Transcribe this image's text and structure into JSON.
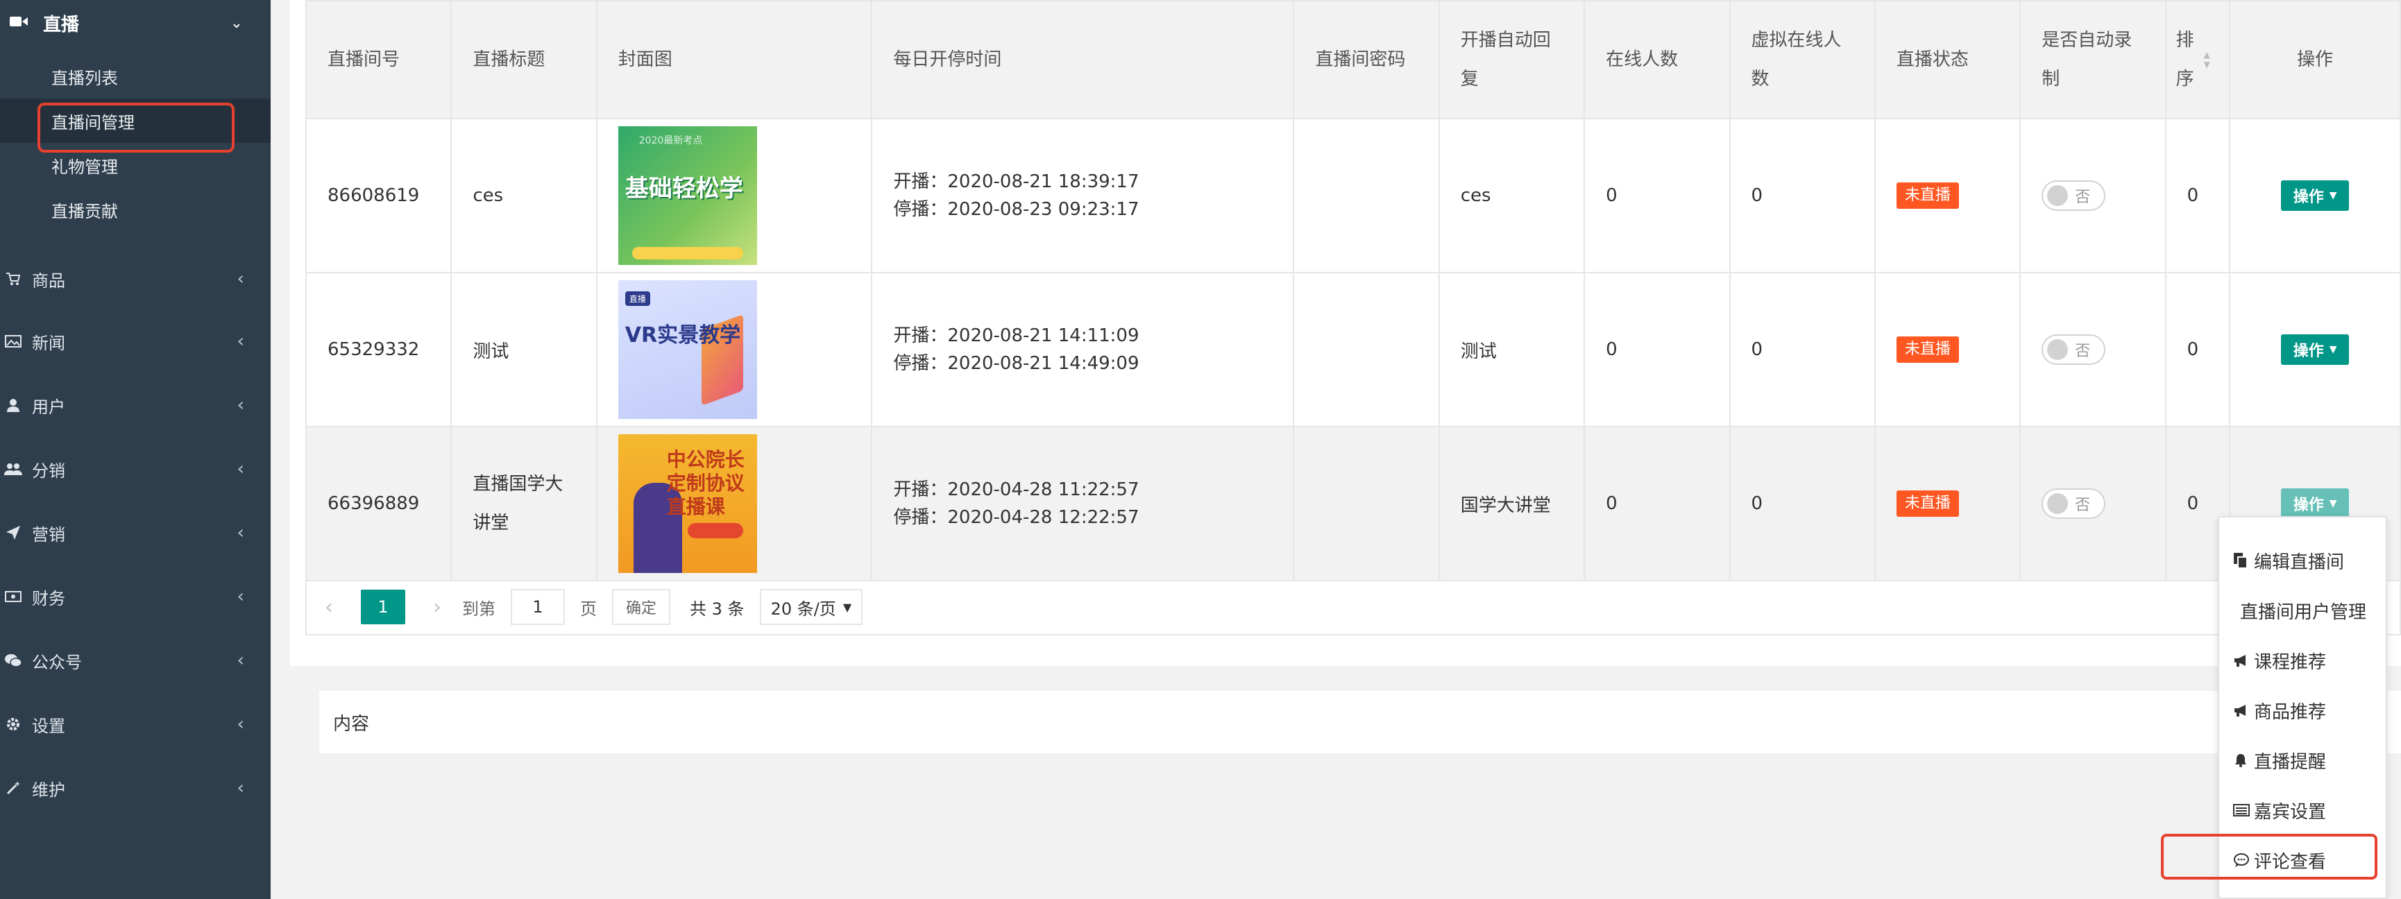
{
  "sidebar": {
    "active_section": "直播",
    "sub_items": [
      "直播列表",
      "直播间管理",
      "礼物管理",
      "直播贡献"
    ],
    "items": [
      {
        "label": "商品",
        "icon": "cart-icon"
      },
      {
        "label": "新闻",
        "icon": "image-icon"
      },
      {
        "label": "用户",
        "icon": "user-icon"
      },
      {
        "label": "分销",
        "icon": "users-icon"
      },
      {
        "label": "营销",
        "icon": "send-icon"
      },
      {
        "label": "财务",
        "icon": "money-icon"
      },
      {
        "label": "公众号",
        "icon": "wechat-icon"
      },
      {
        "label": "设置",
        "icon": "gear-icon"
      },
      {
        "label": "维护",
        "icon": "wand-icon"
      }
    ]
  },
  "table": {
    "headers": [
      "直播间号",
      "直播标题",
      "封面图",
      "每日开停时间",
      "直播间密码",
      "开播自动回复",
      "在线人数",
      "虚拟在线人数",
      "直播状态",
      "是否自动录制",
      "排序",
      "操作"
    ],
    "rows": [
      {
        "room_no": "86608619",
        "title": "ces",
        "cover_text": "基础轻松学",
        "cover_tag": "2020最新考点",
        "start": "开播：2020-08-21 18:39:17",
        "stop": "停播：2020-08-23 09:23:17",
        "password": "",
        "auto_reply": "ces",
        "online": "0",
        "virtual_online": "0",
        "status": "未直播",
        "record": "否",
        "sort": "0",
        "op": "操作"
      },
      {
        "room_no": "65329332",
        "title": "测试",
        "cover_text": "VR实景教学",
        "cover_tag": "直播",
        "start": "开播：2020-08-21 14:11:09",
        "stop": "停播：2020-08-21 14:49:09",
        "password": "",
        "auto_reply": "测试",
        "online": "0",
        "virtual_online": "0",
        "status": "未直播",
        "record": "否",
        "sort": "0",
        "op": "操作"
      },
      {
        "room_no": "66396889",
        "title": "直播国学大讲堂",
        "cover_text": "中公院长定制协议直播课",
        "cover_tag": "",
        "start": "开播：2020-04-28 11:22:57",
        "stop": "停播：2020-04-28 12:22:57",
        "password": "",
        "auto_reply": "国学大讲堂",
        "online": "0",
        "virtual_online": "0",
        "status": "未直播",
        "record": "否",
        "sort": "0",
        "op": "操作"
      }
    ]
  },
  "pager": {
    "current_page": "1",
    "goto_label": "到第",
    "goto_value": "1",
    "page_label": "页",
    "confirm_label": "确定",
    "total": "共 3 条",
    "page_size": "20 条/页"
  },
  "content_card": {
    "label": "内容"
  },
  "dropdown": {
    "items": [
      {
        "label": "编辑直播间",
        "icon": "copy-icon"
      },
      {
        "label": "直播间用户管理",
        "icon": ""
      },
      {
        "label": "课程推荐",
        "icon": "megaphone-icon"
      },
      {
        "label": "商品推荐",
        "icon": "megaphone-icon"
      },
      {
        "label": "直播提醒",
        "icon": "bell-icon"
      },
      {
        "label": "嘉宾设置",
        "icon": "list-icon"
      },
      {
        "label": "评论查看",
        "icon": "comment-icon"
      }
    ]
  },
  "colors": {
    "sidebar_bg": "#2f3e4d",
    "primary": "#009688",
    "status_badge": "#ff5722",
    "highlight_box": "#e6412e"
  }
}
